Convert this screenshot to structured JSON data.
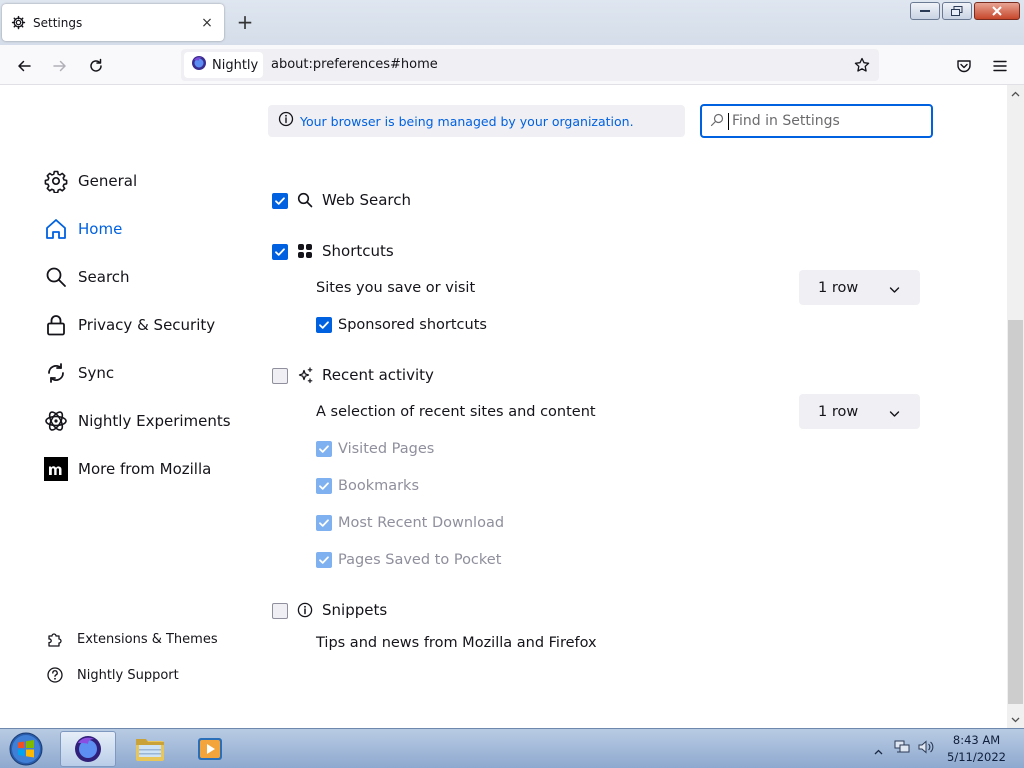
{
  "window": {
    "tab_title": "Settings",
    "tab_close": "×",
    "new_tab": "+"
  },
  "navbar": {
    "identity_label": "Nightly",
    "url": "about:preferences#home"
  },
  "sidebar": {
    "items": [
      {
        "label": "General",
        "icon": "gear-icon"
      },
      {
        "label": "Home",
        "icon": "home-icon"
      },
      {
        "label": "Search",
        "icon": "search-icon"
      },
      {
        "label": "Privacy & Security",
        "icon": "lock-icon"
      },
      {
        "label": "Sync",
        "icon": "sync-icon"
      },
      {
        "label": "Nightly Experiments",
        "icon": "experiments-icon"
      },
      {
        "label": "More from Mozilla",
        "icon": "mozilla-icon"
      }
    ],
    "selected": "Home",
    "footer": [
      {
        "label": "Extensions & Themes",
        "icon": "puzzle-icon"
      },
      {
        "label": "Nightly Support",
        "icon": "help-icon"
      }
    ]
  },
  "policy_notice": "Your browser is being managed by your organization.",
  "search": {
    "placeholder": "Find in Settings",
    "value": ""
  },
  "home_content": {
    "web_search": {
      "label": "Web Search",
      "checked": true
    },
    "shortcuts": {
      "label": "Shortcuts",
      "checked": true,
      "description": "Sites you save or visit",
      "rows": "1 row",
      "sponsored": {
        "label": "Sponsored shortcuts",
        "checked": true
      }
    },
    "recent_activity": {
      "label": "Recent activity",
      "checked": false,
      "description": "A selection of recent sites and content",
      "rows": "1 row",
      "options": [
        {
          "label": "Visited Pages",
          "checked": true,
          "disabled": true
        },
        {
          "label": "Bookmarks",
          "checked": true,
          "disabled": true
        },
        {
          "label": "Most Recent Download",
          "checked": true,
          "disabled": true
        },
        {
          "label": "Pages Saved to Pocket",
          "checked": true,
          "disabled": true
        }
      ]
    },
    "snippets": {
      "label": "Snippets",
      "checked": false,
      "description": "Tips and news from Mozilla and Firefox"
    }
  },
  "taskbar": {
    "time": "8:43 AM",
    "date": "5/11/2022"
  },
  "colors": {
    "accent": "#0061e0",
    "disabled_check": "#7fb0ef",
    "disabled_text": "#8f8f9d"
  }
}
